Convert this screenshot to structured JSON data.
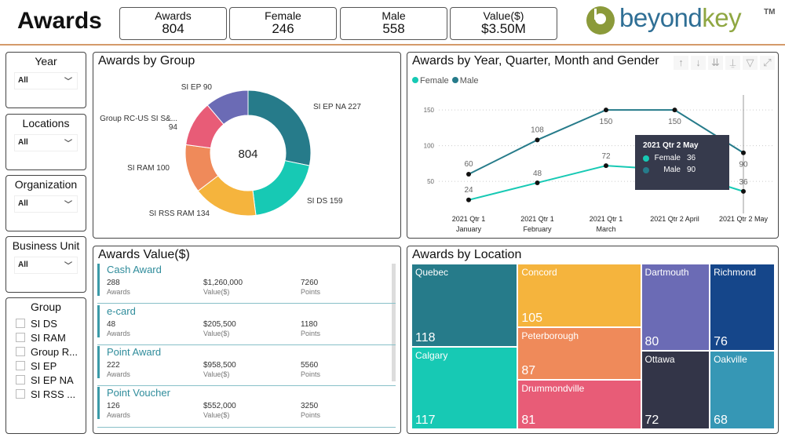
{
  "header": {
    "title": "Awards",
    "kpis": [
      {
        "label": "Awards",
        "value": "804"
      },
      {
        "label": "Female",
        "value": "246"
      },
      {
        "label": "Male",
        "value": "558"
      },
      {
        "label": "Value($)",
        "value": "$3.50M"
      }
    ],
    "logo": {
      "part1": "beyond",
      "part2": "key",
      "tm": "TM",
      "icon": "beyondkey-logo-icon"
    }
  },
  "slicers": [
    {
      "title": "Year",
      "value": "All"
    },
    {
      "title": "Locations",
      "value": "All"
    },
    {
      "title": "Organization",
      "value": "All"
    },
    {
      "title": "Business Unit",
      "value": "All"
    }
  ],
  "group_slicer": {
    "title": "Group",
    "items": [
      "SI DS",
      "SI RAM",
      "Group R...",
      "SI EP",
      "SI EP NA",
      "SI RSS ..."
    ]
  },
  "colors": {
    "teal_dark": "#267b8a",
    "teal_light": "#17c9b4",
    "orange": "#f5b43d",
    "salmon": "#ef8a5a",
    "pink": "#e85c77",
    "purple": "#6b6bb5",
    "navy": "#15468a",
    "dark": "#333548",
    "blue": "#3697b5"
  },
  "chart_data": [
    {
      "type": "pie",
      "title": "Awards by Group",
      "center_label": "804",
      "slices": [
        {
          "label": "SI EP NA",
          "value": 227,
          "display": "SI EP NA 227"
        },
        {
          "label": "SI DS",
          "value": 159,
          "display": "SI DS 159"
        },
        {
          "label": "SI RSS RAM",
          "value": 134,
          "display": "SI RSS RAM 134"
        },
        {
          "label": "SI RAM",
          "value": 100,
          "display": "SI RAM 100"
        },
        {
          "label": "Group RC-US SI S&...",
          "value": 94,
          "display": "Group RC-US SI S&...",
          "display2": "94"
        },
        {
          "label": "SI EP",
          "value": 90,
          "display": "SI EP 90"
        }
      ]
    },
    {
      "type": "line",
      "title": "Awards by Year, Quarter, Month and Gender",
      "categories": [
        [
          "2021 Qtr 1",
          "January"
        ],
        [
          "2021 Qtr 1",
          "February"
        ],
        [
          "2021 Qtr 1",
          "March"
        ],
        [
          "2021 Qtr 2 April",
          ""
        ],
        [
          "2021 Qtr 2 May",
          ""
        ]
      ],
      "series": [
        {
          "name": "Female",
          "values": [
            24,
            48,
            72,
            66,
            36
          ]
        },
        {
          "name": "Male",
          "values": [
            60,
            108,
            150,
            150,
            90
          ]
        }
      ],
      "yticks": [
        "50",
        "100",
        "150"
      ],
      "ylim": [
        15,
        160
      ],
      "legend": "top-left",
      "data_labels": {
        "Female": [
          "24",
          "48",
          "72",
          "",
          "36"
        ],
        "Male": [
          "60",
          "108",
          "150",
          "150",
          "90"
        ]
      },
      "tooltip": {
        "title": "2021 Qtr 2 May",
        "rows": [
          {
            "name": "Female",
            "value": "36"
          },
          {
            "name": "Male",
            "value": "90"
          }
        ]
      }
    },
    {
      "type": "treemap",
      "title": "Awards by Location",
      "items": [
        {
          "label": "Quebec",
          "value": 118
        },
        {
          "label": "Calgary",
          "value": 117
        },
        {
          "label": "Concord",
          "value": 105
        },
        {
          "label": "Peterborough",
          "value": 87
        },
        {
          "label": "Drummondville",
          "value": 81
        },
        {
          "label": "Dartmouth",
          "value": 80
        },
        {
          "label": "Ottawa",
          "value": 72
        },
        {
          "label": "Richmond",
          "value": 76
        },
        {
          "label": "Oakville",
          "value": 68
        }
      ]
    }
  ],
  "awards_value": {
    "title": "Awards Value($)",
    "labels": {
      "awards": "Awards",
      "value": "Value($)",
      "points": "Points"
    },
    "cards": [
      {
        "name": "Cash Award",
        "awards": "288",
        "value": "$1,260,000",
        "points": "7260"
      },
      {
        "name": "e-card",
        "awards": "48",
        "value": "$205,500",
        "points": "1180"
      },
      {
        "name": "Point Award",
        "awards": "222",
        "value": "$958,500",
        "points": "5560"
      },
      {
        "name": "Point Voucher",
        "awards": "126",
        "value": "$552,000",
        "points": "3250"
      }
    ]
  },
  "toolbar": {
    "up": "↑",
    "down": "↓",
    "expand_all": "⇊",
    "hierarchy": "⍊",
    "filter": "▽",
    "focus": "⤢"
  }
}
